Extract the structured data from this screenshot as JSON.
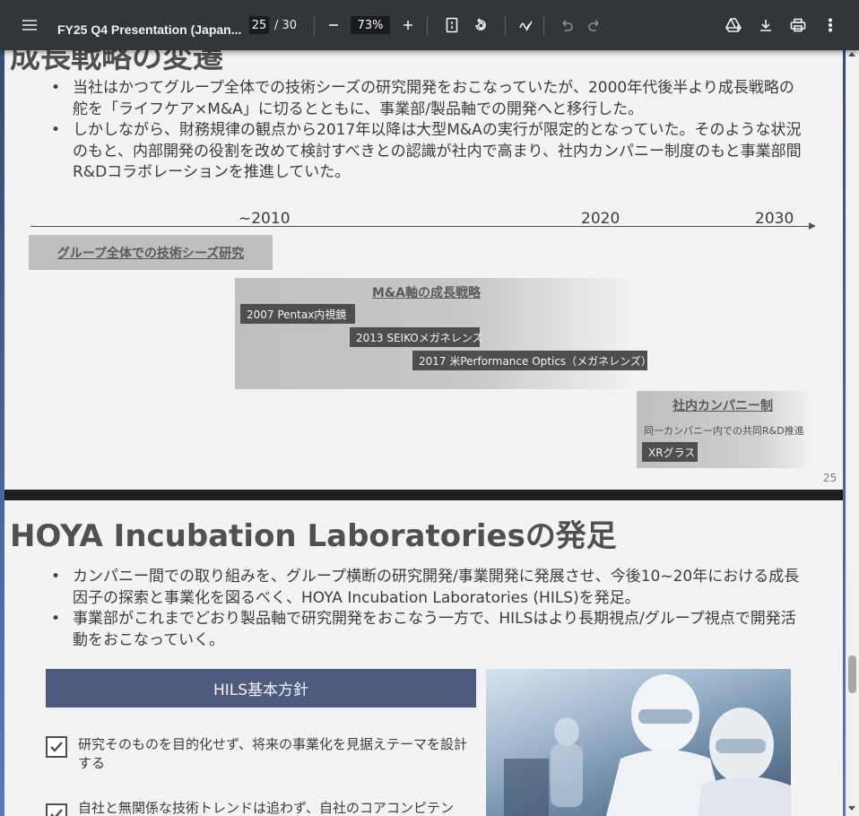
{
  "toolbar": {
    "title": "FY25 Q4 Presentation (Japan...",
    "current_page": "25",
    "total_pages": "/ 30",
    "zoom": "73%"
  },
  "page1": {
    "title": "成長戦略の変遷",
    "bullets": [
      "当社はかつてグループ全体での技術シーズの研究開発をおこなっていたが、2000年代後半より成長戦略の舵を「ライフケア×M&A」に切るとともに、事業部/製品軸での開発へと移行した。",
      "しかしながら、財務規律の観点から2017年以降は大型M&Aの実行が限定的となっていた。そのような状況のもと、内部開発の役割を改めて検討すべきとの認識が社内で高まり、社内カンパニー制度のもと事業部間R&Dコラボレーションを推進していた。"
    ],
    "timeline": {
      "year_2010": "~2010",
      "year_2020": "2020",
      "year_2030": "2030"
    },
    "group_box": "グループ全体での技術シーズ研究",
    "ma_box": {
      "title": "M&A軸の成長戦略",
      "items": [
        "2007 Pentax内視鏡",
        "2013 SEIKOメガネレンズ",
        "2017 米Performance Optics（メガネレンズ）"
      ]
    },
    "company_box": {
      "title": "社内カンパニー制",
      "subtitle": "同一カンパニー内での共同R&D推進",
      "tag": "XRグラス"
    },
    "page_number": "25"
  },
  "page2": {
    "title": "HOYA Incubation Laboratoriesの発足",
    "bullets": [
      "カンパニー間での取り組みを、グループ横断の研究開発/事業開発に発展させ、今後10~20年における成長因子の探索と事業化を図るべく、HOYA Incubation Laboratories (HILS)を発足。",
      "事業部がこれまでどおり製品軸で研究開発をおこなう一方で、HILSはより長期視点/グループ視点で開発活動をおこなっていく。"
    ],
    "hils_heading": "HILS基本方針",
    "checklist": [
      "研究そのものを目的化せず、将来の事業化を見据えテーマを設計する",
      "自社と無関係な技術トレンドは追わず、自社のコアコンピテン"
    ]
  },
  "colors": {
    "toolbar_bg": "#323639",
    "hils_heading_bg": "#4f5a7e",
    "page_bg": "#f3f3f3"
  }
}
